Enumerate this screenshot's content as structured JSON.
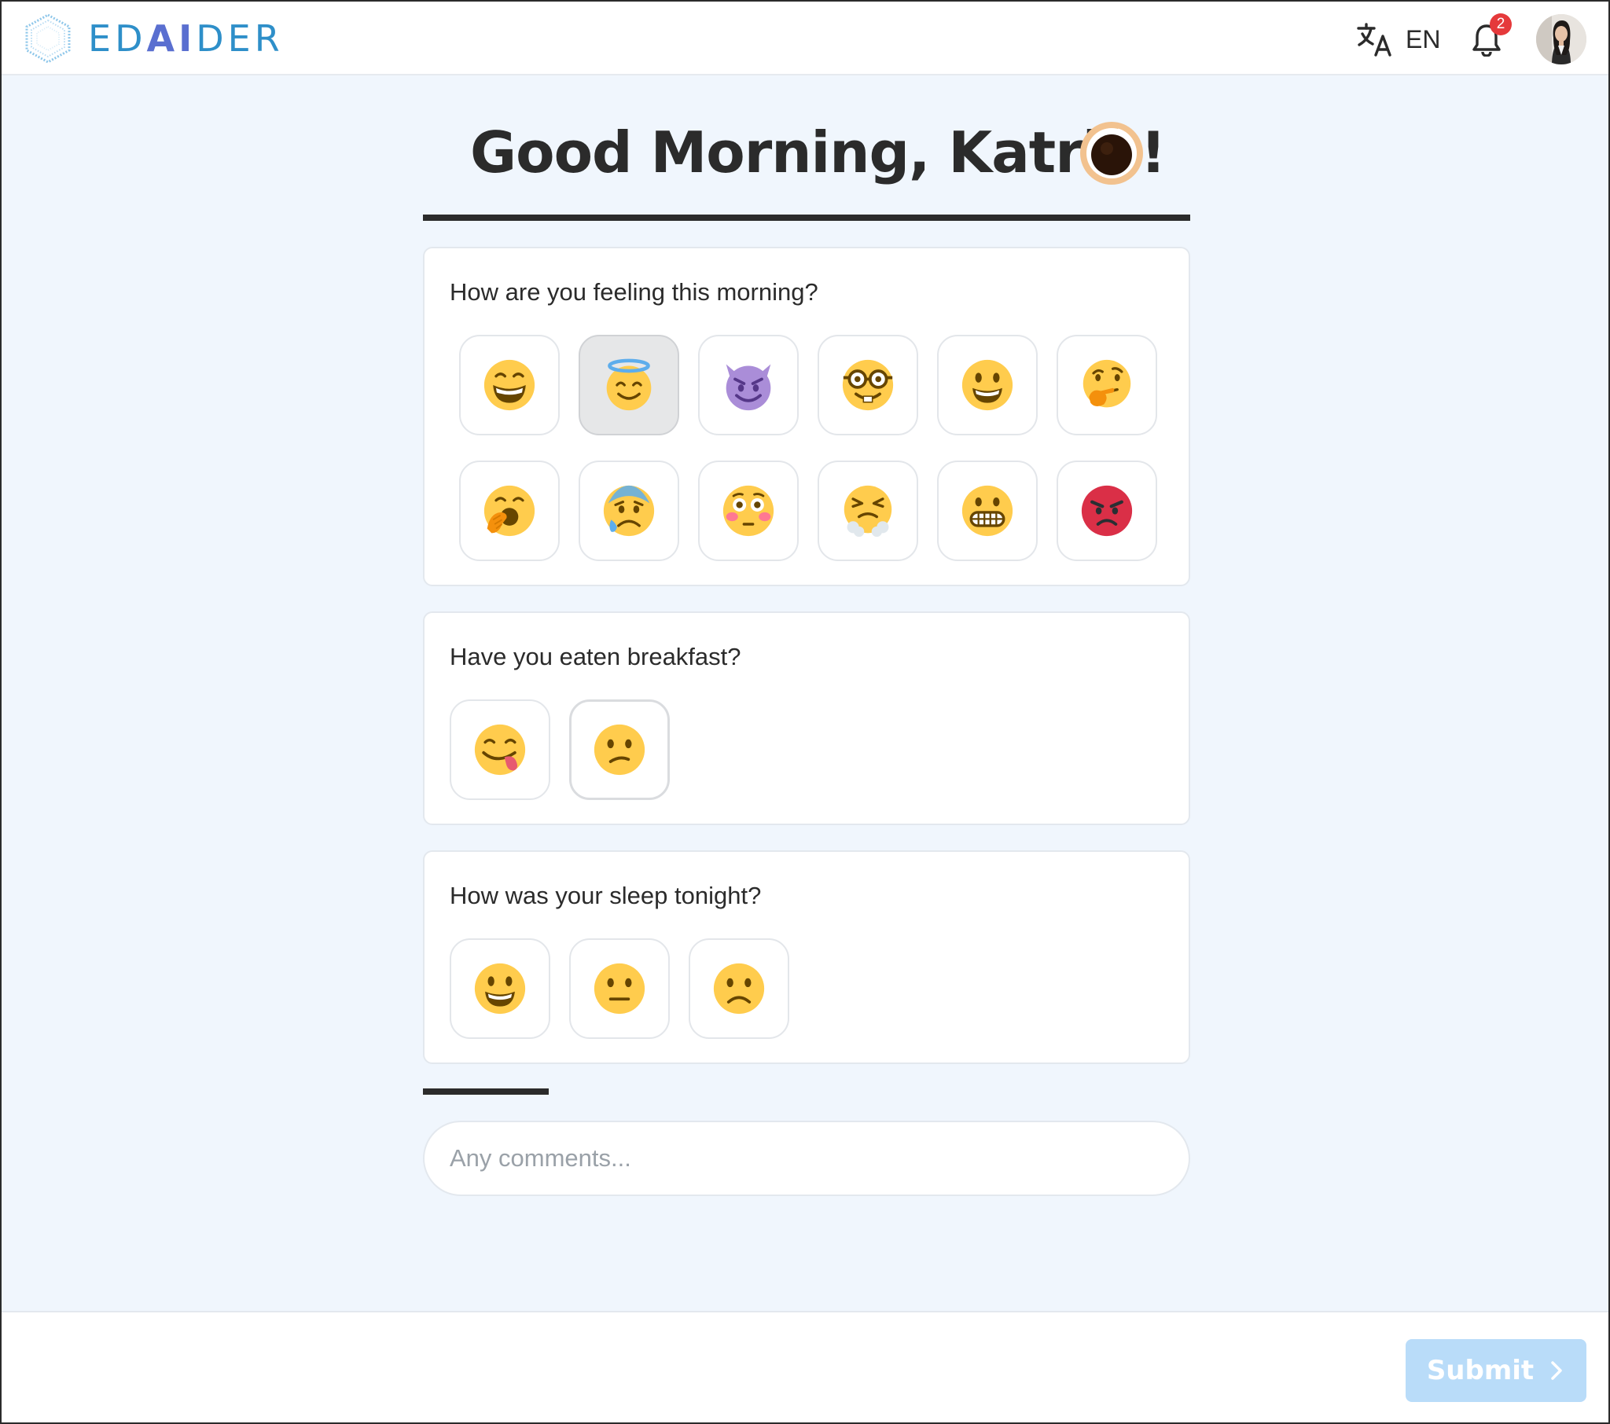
{
  "header": {
    "logo_parts": [
      "ED",
      "AI",
      "DER"
    ],
    "language": "EN",
    "notification_count": "2",
    "translate_icon": "translate-icon",
    "bell_icon": "bell-icon"
  },
  "greeting": {
    "title": "Good Morning, Katrin!",
    "icon": "coffee-icon"
  },
  "questions": [
    {
      "question": "How are you feeling this morning?",
      "options": [
        "grinning-squinting",
        "smiling-halo",
        "smiling-devil",
        "nerd",
        "smiley",
        "thinking",
        "yawning",
        "anxious-sweat",
        "flushed",
        "steam-from-nose",
        "grimacing",
        "pouting"
      ],
      "selected": "smiling-halo"
    },
    {
      "question": "Have you eaten breakfast?",
      "options": [
        "yum",
        "confused"
      ]
    },
    {
      "question": "How was your sleep tonight?",
      "options": [
        "smiley",
        "neutral",
        "slightly-frowning"
      ]
    }
  ],
  "comments": {
    "placeholder": "Any comments..."
  },
  "footer": {
    "submit_label": "Submit"
  },
  "colors": {
    "background": "#f0f6fd",
    "accent": "#2e8fc9",
    "submit_disabled": "#b9dcf9",
    "badge": "#e5393b",
    "emoji_yellow": "#ffcc4d"
  }
}
